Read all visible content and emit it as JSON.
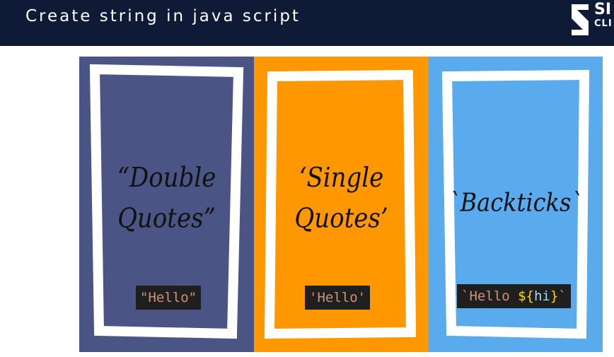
{
  "header": {
    "title": "Create string in java script",
    "logo_line1": "SI",
    "logo_line2": "CLI"
  },
  "colors": {
    "header_bg": "#0e1a36",
    "panel_double": "#4a5585",
    "panel_single": "#ff9800",
    "panel_backtick": "#5aaaee",
    "code_bg": "#1f1f1f",
    "code_string": "#ce9178",
    "code_punctuation": "#ffd700",
    "code_variable": "#9cdcfe"
  },
  "panels": [
    {
      "title_line1": "“Double",
      "title_line2": "Quotes”",
      "code": "\"Hello\""
    },
    {
      "title_line1": "‘Single",
      "title_line2": "Quotes’",
      "code": "'Hello'"
    },
    {
      "title_line1": "`Backticks`",
      "code_prefix": "`Hello ",
      "code_open": "${",
      "code_var": "hi",
      "code_close": "}",
      "code_suffix": "`"
    }
  ]
}
